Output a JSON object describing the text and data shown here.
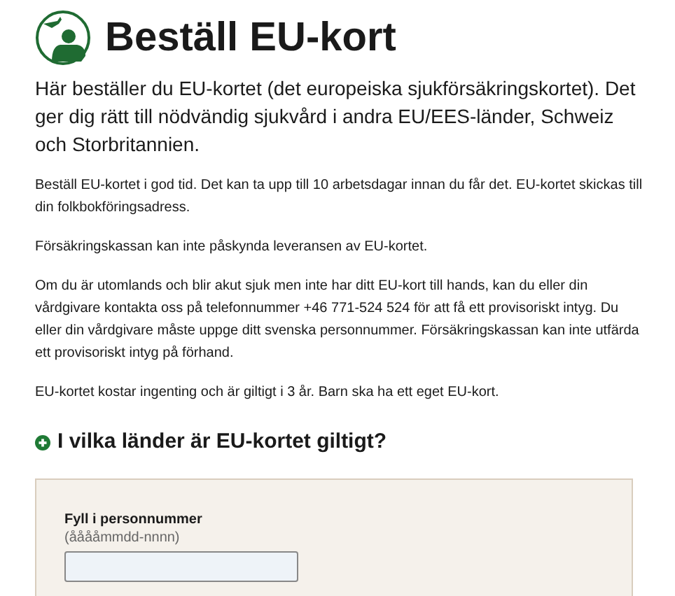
{
  "title": "Beställ EU-kort",
  "intro": "Här beställer du EU-kortet (det europeiska sjukförsäkringskortet). Det ger dig rätt till nödvändig sjukvård i andra EU/EES-länder, Schweiz och Storbritannien.",
  "paragraphs": [
    "Beställ EU-kortet i god tid. Det kan ta upp till 10 arbetsdagar innan du får det. EU-kortet skickas till din folkbokföringsadress.",
    "Försäkringskassan kan inte påskynda leveransen av EU-kortet.",
    "Om du är utomlands och blir akut sjuk men inte har ditt EU-kort till hands, kan du eller din vårdgivare kontakta oss på telefonnummer +46 771-524 524 för att få ett provisoriskt intyg. Du eller din vårdgivare måste uppge ditt svenska personnummer. Försäkringskassan kan inte utfärda ett provisoriskt intyg på förhand.",
    "EU-kortet kostar ingenting och är giltigt i 3 år. Barn ska ha ett eget EU-kort."
  ],
  "accordion": {
    "label": "I vilka länder är EU-kortet giltigt?",
    "expanded": false
  },
  "form": {
    "label": "Fyll i personnummer",
    "hint": "(ååååmmdd-nnnn)"
  }
}
